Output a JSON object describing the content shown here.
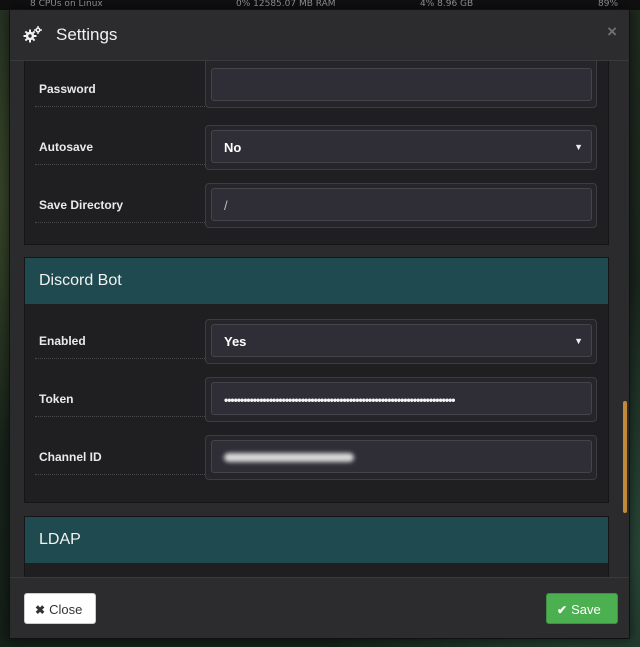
{
  "topbar": {
    "cpu": "8 CPUs on Linux",
    "mem": "0%  12585.07 MB RAM",
    "disk": "4%  8.96 GB",
    "pct": "89%"
  },
  "modal": {
    "title": "Settings",
    "icon": "gears-icon",
    "close_glyph": "×"
  },
  "general": {
    "password": {
      "label": "Password",
      "value": ""
    },
    "autosave": {
      "label": "Autosave",
      "value": "No"
    },
    "save_directory": {
      "label": "Save Directory",
      "placeholder": "/"
    }
  },
  "discord": {
    "title": "Discord Bot",
    "enabled": {
      "label": "Enabled",
      "value": "Yes"
    },
    "token": {
      "label": "Token",
      "value": "••••••••••••••••••••••••••••••••••••••••••••••••••••••••••••••••••••••••"
    },
    "channel_id": {
      "label": "Channel ID"
    }
  },
  "ldap": {
    "title": "LDAP"
  },
  "footer": {
    "close_label": "Close",
    "save_label": "Save"
  },
  "colors": {
    "panel_header": "#1f4a4f",
    "save_button": "#4caf50",
    "scrollbar": "#c08a3a"
  }
}
